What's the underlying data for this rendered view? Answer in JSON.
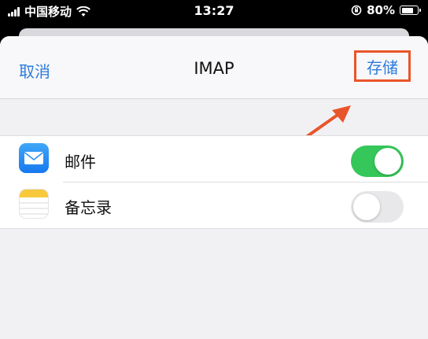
{
  "status_bar": {
    "carrier": "中国移动",
    "time": "13:27",
    "battery_percent": "80%",
    "battery_level": 0.8,
    "icons": [
      "signal-icon",
      "wifi-icon",
      "orientation-lock-icon",
      "battery-icon"
    ]
  },
  "nav": {
    "cancel_label": "取消",
    "title": "IMAP",
    "save_label": "存储"
  },
  "annotation": {
    "highlight_color": "#e9552a",
    "arrow_icon": "pointer-arrow-icon"
  },
  "list": {
    "items": [
      {
        "label": "邮件",
        "icon": "mail-icon",
        "enabled": true
      },
      {
        "label": "备忘录",
        "icon": "notes-icon",
        "enabled": false
      }
    ]
  },
  "colors": {
    "accent": "#2d7bdc",
    "toggle_on": "#35c759",
    "toggle_off": "#e8e8ea"
  }
}
